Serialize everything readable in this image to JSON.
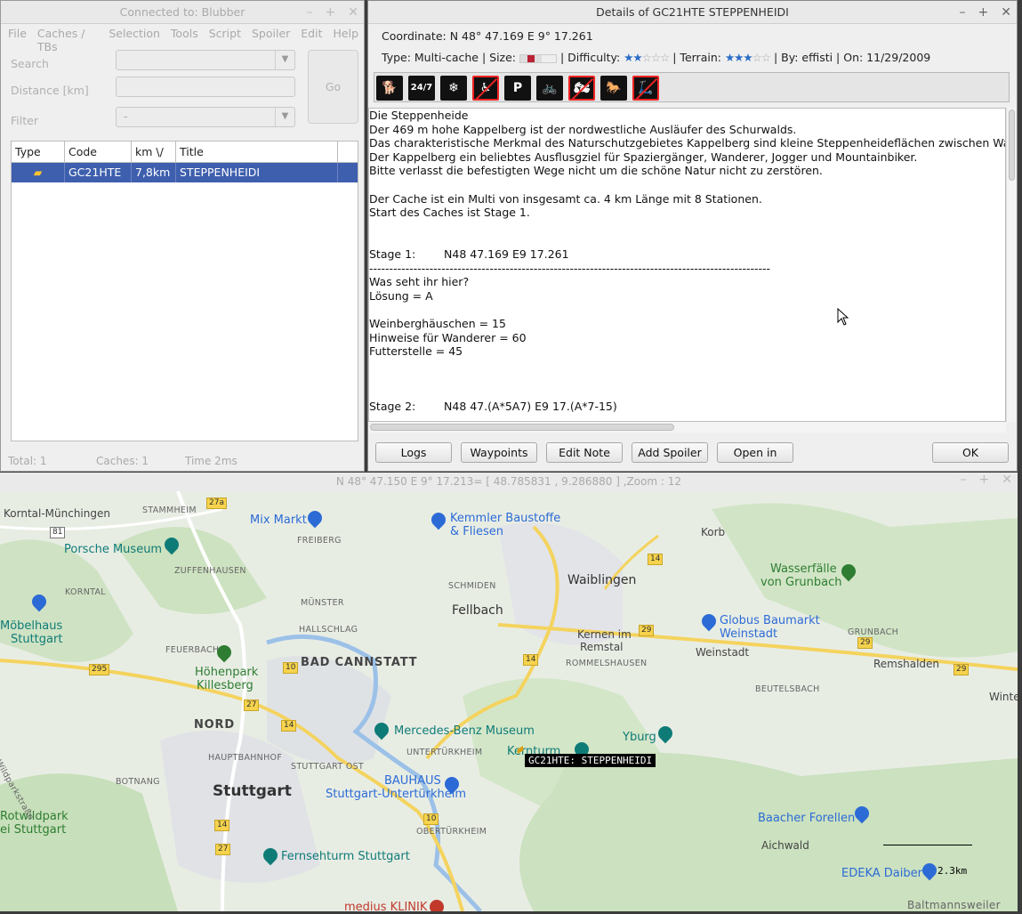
{
  "main_window": {
    "title": "Connected to: Blubber",
    "menu": [
      "File",
      "Caches / TBs",
      "Selection",
      "Tools",
      "Script",
      "Spoiler",
      "Edit",
      "Help"
    ],
    "search_label": "Search",
    "distance_label": "Distance [km]",
    "filter_label": "Filter",
    "filter_value": "-",
    "go_label": "Go",
    "table": {
      "columns": [
        "Type",
        "Code",
        "km \\/",
        "Title"
      ],
      "rows": [
        {
          "type_icon": "multi-cache-icon",
          "code": "GC21HTE",
          "km": "7,8km",
          "title": "STEPPENHEIDI"
        }
      ]
    },
    "status": {
      "total": "Total: 1",
      "caches": "Caches: 1",
      "time": "Time 2ms"
    }
  },
  "details_window": {
    "title": "Details of GC21HTE STEPPENHEIDI",
    "coordinate": "Coordinate: N 48° 47.169 E 9° 17.261",
    "type_text": "Type: Multi-cache | Size:",
    "difficulty_label": "| Difficulty:",
    "difficulty_stars": 2,
    "terrain_label": "| Terrain:",
    "terrain_stars": 3,
    "by_text": "| By: effisti | On: 11/29/2009",
    "attributes": [
      {
        "name": "dogs-icon",
        "glyph": "🐕",
        "negated": false
      },
      {
        "name": "24-7-icon",
        "glyph": "24/7",
        "negated": false
      },
      {
        "name": "winter-icon",
        "glyph": "❄",
        "negated": false
      },
      {
        "name": "wheelchair-icon",
        "glyph": "♿",
        "negated": true
      },
      {
        "name": "parking-icon",
        "glyph": "P",
        "negated": false
      },
      {
        "name": "bicycles-icon",
        "glyph": "🚲",
        "negated": false
      },
      {
        "name": "motorcycles-icon",
        "glyph": "🏍",
        "negated": true
      },
      {
        "name": "horses-icon",
        "glyph": "🐎",
        "negated": false
      },
      {
        "name": "scooter-icon",
        "glyph": "🛴",
        "negated": true
      }
    ],
    "description_lines": [
      "Die Steppenheide",
      "Der 469 m hohe Kappelberg ist der nordwestliche Ausläufer des Schurwalds.",
      "Das charakteristische Merkmal des Naturschutzgebietes Kappelberg sind kleine Steppenheideflächen zwischen Wald und",
      "Der Kappelberg ein beliebtes Ausflusgziel für Spaziergänger, Wanderer, Jogger und Mountainbiker.",
      "Bitte verlasst die befestigten Wege nicht um die schöne Natur nicht zu zerstören.",
      "",
      "Der Cache ist ein Multi von insgesamt ca. 4 km Länge mit 8 Stationen.",
      "Start des Caches ist Stage 1.",
      "",
      "",
      "Stage 1:        N48 47.169 E9 17.261",
      "----------------------------------------------------------------------------------------------------",
      "Was seht ihr hier?",
      "Lösung = A",
      "",
      "Weinberghäuschen = 15",
      "Hinweise für Wanderer = 60",
      "Futterstelle = 45",
      "",
      "",
      "",
      "Stage 2:        N48 47.(A*5A7) E9 17.(A*7-15)"
    ],
    "buttons": {
      "logs": "Logs",
      "waypoints": "Waypoints",
      "edit_note": "Edit Note",
      "add_spoiler": "Add Spoiler",
      "open_browser": "Open in brows",
      "ok": "OK"
    }
  },
  "map_window": {
    "title": "N 48° 47.150 E 9° 17.213= [ 48.785831 , 9.286880 ] ,Zoom : 12",
    "cache_label": "GC21HTE: STEPPENHEIDI",
    "scale_label": "2.3km",
    "places": {
      "korntal": "Korntal-Münchingen",
      "stammheim": "STAMMHEIM",
      "mixmarkt": "Mix Markt",
      "kemmler1": "Kemmler Baustoffe",
      "kemmler2": "& Fliesen",
      "korb": "Korb",
      "porsche": "Porsche Museum",
      "freiberg": "FREIBERG",
      "zuffenhausen": "ZUFFENHAUSEN",
      "schmiden": "SCHMIDEN",
      "waiblingen": "Waiblingen",
      "wasserfaelle1": "Wasserfälle",
      "wasserfaelle2": "von Grunbach",
      "korntal2": "KORNTAL",
      "moebelhaus1": "Möbelhaus",
      "moebelhaus2": "Stuttgart",
      "muenster": "MÜNSTER",
      "fellbach": "Fellbach",
      "hallschlag": "HALLSCHLAG",
      "globus1": "Globus Baumarkt",
      "globus2": "Weinstadt",
      "feuerbach": "FEUERBACH",
      "kernen1": "Kernen im",
      "kernen2": "Remstal",
      "grunbach": "GRUNBACH",
      "weinstadt": "Weinstadt",
      "remshalden": "Remshalden",
      "rommelshausen": "ROMMELSHAUSEN",
      "badcannstatt": "BAD CANNSTATT",
      "hoehenpark1": "Höhenpark",
      "hoehenpark2": "Killesberg",
      "beutelsbach": "BEUTELSBACH",
      "winte": "Winte",
      "nord": "NORD",
      "mercedes": "Mercedes-Benz Museum",
      "yburg": "Yburg",
      "kernturm": "Kernturm",
      "untertuerkheim_s": "UNTERTÜRKHEIM",
      "hauptbahnhof": "HAUPTBAHNHOF",
      "stuttgartost": "STUTTGART OST",
      "botnang": "BOTNANG",
      "bauhaus1": "BAUHAUS",
      "bauhaus2": "Stuttgart-Untertürkheim",
      "stuttgart": "Stuttgart",
      "wildpark1": "Rotwildpark",
      "wildpark2": "ei Stuttgart",
      "baacher": "Baacher Forellen",
      "obertuerkheim": "OBERTÜRKHEIM",
      "aichwald": "Aichwald",
      "fernseh": "Fernsehturm Stuttgart",
      "edeka": "EDEKA Daiber",
      "medius": "medius KLINIK",
      "baltmanns": "Baltmannsweiler",
      "wildparkstr": "Wildparkstraße"
    }
  }
}
